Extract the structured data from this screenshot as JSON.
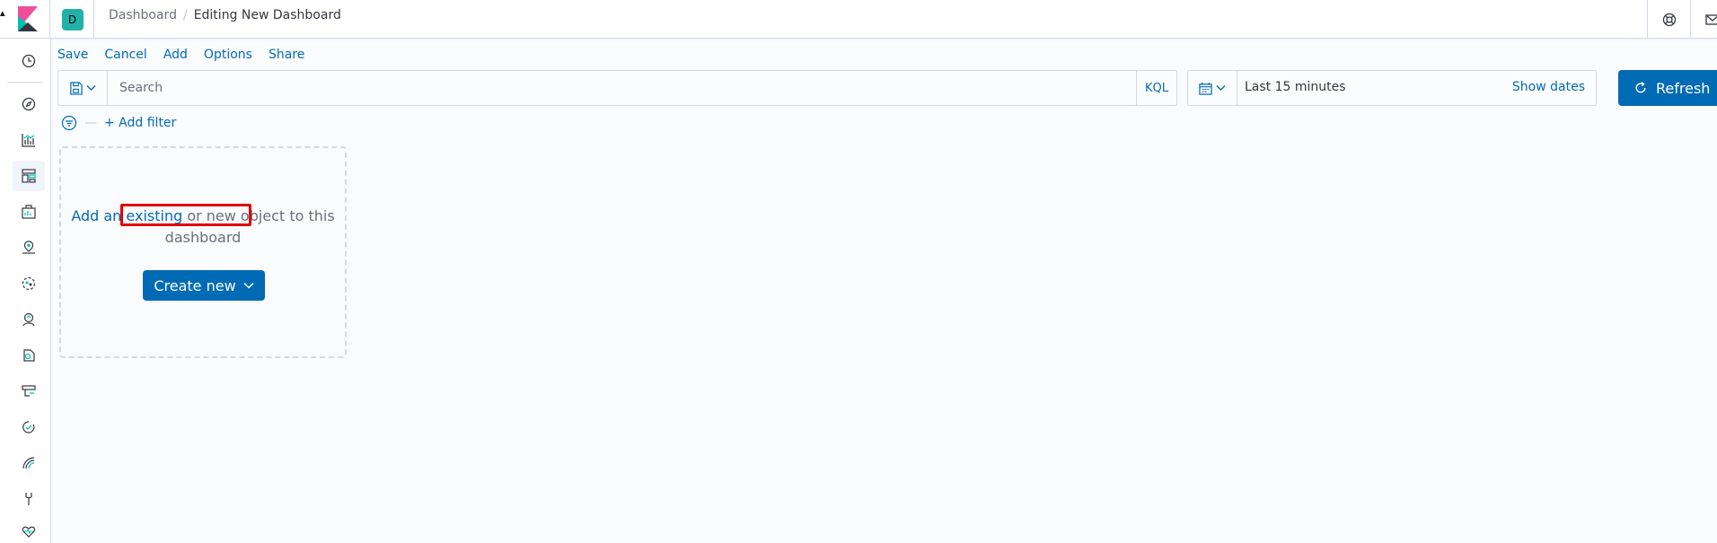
{
  "header": {
    "space_initial": "D",
    "breadcrumbs": [
      "Dashboard",
      "Editing New Dashboard"
    ],
    "icons": [
      "kibana-logo-icon",
      "help-icon",
      "mail-icon"
    ]
  },
  "sidenav": {
    "items": [
      "clock-icon",
      "compass-icon",
      "visualize-icon",
      "dashboard-icon",
      "canvas-icon",
      "maps-icon",
      "ml-icon",
      "apm-icon",
      "siem-icon",
      "logs-icon",
      "uptime-icon",
      "monitoring-icon",
      "dev-tools-icon",
      "heartbeat-icon"
    ],
    "active": "dashboard-icon"
  },
  "topmenu": {
    "save": "Save",
    "cancel": "Cancel",
    "add": "Add",
    "options": "Options",
    "share": "Share"
  },
  "query": {
    "placeholder": "Search",
    "language": "KQL"
  },
  "datepicker": {
    "range": "Last 15 minutes",
    "show_dates": "Show dates",
    "refresh": "Refresh"
  },
  "filter": {
    "add_filter": "+ Add filter"
  },
  "empty_panel": {
    "link_text": "Add an existing",
    "rest_text": " or new object to this dashboard",
    "create_new": "Create new"
  },
  "colors": {
    "accent": "#006bb4",
    "highlight": "#e10000",
    "space": "#20b2aa"
  }
}
